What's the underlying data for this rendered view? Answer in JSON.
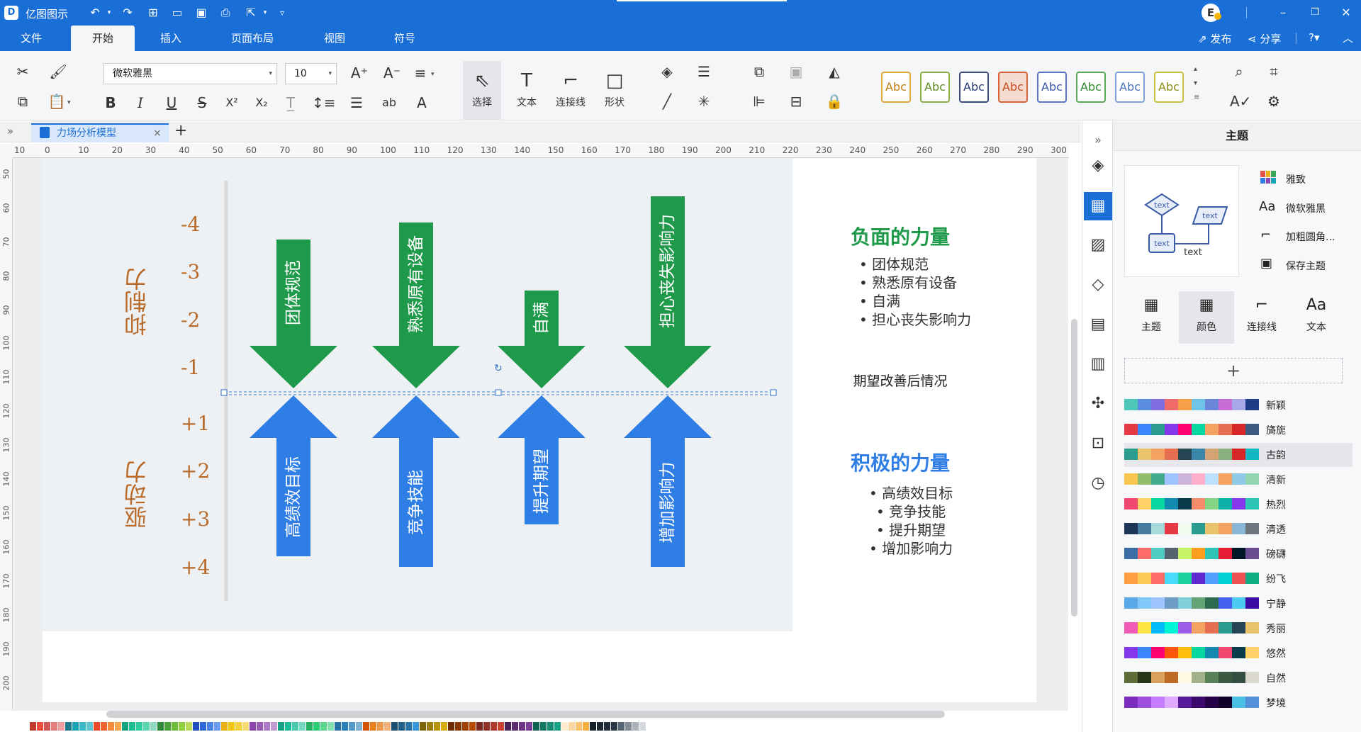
{
  "app": {
    "title": "亿图图示"
  },
  "menu_tabs": [
    "文件",
    "开始",
    "插入",
    "页面布局",
    "视图",
    "符号"
  ],
  "title_actions": {
    "avatar": "E",
    "publish": "发布",
    "share": "分享"
  },
  "ribbon": {
    "font_family": "微软雅黑",
    "font_size": "10",
    "big_buttons": [
      "选择",
      "文本",
      "连接线",
      "形状"
    ],
    "style_swatches": [
      {
        "label": "Abc",
        "border": "#e0a840",
        "color": "#c07c10"
      },
      {
        "label": "Abc",
        "border": "#8cae4a",
        "color": "#5d8a20"
      },
      {
        "label": "Abc",
        "border": "#3a4e82",
        "color": "#253a70"
      },
      {
        "label": "Abc",
        "border": "#d8633a",
        "color": "#c04a20"
      },
      {
        "label": "Abc",
        "border": "#5a74c8",
        "color": "#3a54a8"
      },
      {
        "label": "Abc",
        "border": "#58a858",
        "color": "#2f8a2f"
      },
      {
        "label": "Abc",
        "border": "#7ea0d8",
        "color": "#4a70b8"
      },
      {
        "label": "Abc",
        "border": "#c8c040",
        "color": "#8a8a10"
      }
    ]
  },
  "document": {
    "tab_label": "力场分析模型"
  },
  "ruler": {
    "h_labels": [
      "10",
      "0",
      "10",
      "20",
      "30",
      "40",
      "50",
      "60",
      "70",
      "80",
      "90",
      "100",
      "110",
      "120",
      "130",
      "140",
      "150",
      "160",
      "170",
      "180",
      "190",
      "200",
      "210",
      "220",
      "230",
      "240",
      "250",
      "260",
      "270",
      "280",
      "290",
      "300"
    ],
    "v_labels": [
      "50",
      "60",
      "70",
      "80",
      "90",
      "100",
      "110",
      "120",
      "130",
      "140",
      "150",
      "160",
      "170",
      "180",
      "190",
      "200"
    ]
  },
  "diagram": {
    "restrain_label": "抑制力",
    "drive_label": "驱动力",
    "scale_neg": [
      "-4",
      "-3",
      "-2",
      "-1"
    ],
    "scale_pos": [
      "+1",
      "+2",
      "+3",
      "+4"
    ],
    "down_arrows": [
      "团体规范",
      "熟悉原有设备",
      "自满",
      "担心丧失影响力"
    ],
    "up_arrows": [
      "高绩效目标",
      "竞争技能",
      "提升期望",
      "增加影响力"
    ],
    "green": "#1f9a4a",
    "blue": "#2f7ee6",
    "negative_title": "负面的力量",
    "negative_items": [
      "团体规范",
      "熟悉原有设备",
      "自满",
      "担心丧失影响力"
    ],
    "expectation_text": "期望改善后情况",
    "positive_title": "积极的力量",
    "positive_items": [
      "高绩效目标",
      "竞争技能",
      "提升期望",
      "增加影响力"
    ]
  },
  "panel": {
    "title": "主题",
    "preview_text": [
      "text",
      "text",
      "text",
      "text"
    ],
    "options": [
      "雅致",
      "微软雅黑",
      "加粗圆角...",
      "保存主题"
    ],
    "tabs": [
      "主题",
      "颜色",
      "连接线",
      "文本"
    ],
    "add_label": "+",
    "color_themes": [
      {
        "name": "新颖",
        "colors": [
          "#4fc7b8",
          "#5a8de0",
          "#7e6ee0",
          "#f06a6a",
          "#f6a04a",
          "#6fc4e8",
          "#6b86d6",
          "#c76ed6",
          "#a8a8e8",
          "#1f3c88"
        ]
      },
      {
        "name": "旖旎",
        "colors": [
          "#e63946",
          "#3a86ff",
          "#2a9d8f",
          "#8338ec",
          "#ff006e",
          "#06d6a0",
          "#f4a261",
          "#e76f51",
          "#d62828",
          "#3d5a80"
        ]
      },
      {
        "name": "古韵",
        "colors": [
          "#2a9d8f",
          "#e9c46a",
          "#f4a261",
          "#e76f51",
          "#264653",
          "#3a86a8",
          "#d4a373",
          "#8ab17d",
          "#d62828",
          "#14b8c4"
        ]
      },
      {
        "name": "清新",
        "colors": [
          "#f9c74f",
          "#90be6d",
          "#43aa8b",
          "#a0c4ff",
          "#cdb4db",
          "#ffafcc",
          "#bde0fe",
          "#f4a261",
          "#8ecae6",
          "#95d5b2"
        ]
      },
      {
        "name": "热烈",
        "colors": [
          "#ef476f",
          "#ffd166",
          "#06d6a0",
          "#118ab2",
          "#073b4c",
          "#f78c6b",
          "#83d483",
          "#0cb0a9",
          "#8338ec",
          "#2ec4b6"
        ]
      },
      {
        "name": "清透",
        "colors": [
          "#1d3557",
          "#457b9d",
          "#a8dadc",
          "#e63946",
          "#f1faee",
          "#2a9d8f",
          "#e9c46a",
          "#f4a261",
          "#8ab6d6",
          "#6c757d"
        ]
      },
      {
        "name": "磅礴",
        "colors": [
          "#3a6ea5",
          "#ff6b6b",
          "#4ecdc4",
          "#556270",
          "#c7f464",
          "#ff9f1c",
          "#2ec4b6",
          "#e71d36",
          "#011627",
          "#6a4c93"
        ]
      },
      {
        "name": "纷飞",
        "colors": [
          "#ff9f43",
          "#feca57",
          "#ff6b6b",
          "#48dbfb",
          "#1dd1a1",
          "#5f27cd",
          "#54a0ff",
          "#00d2d3",
          "#ee5253",
          "#10ac84"
        ]
      },
      {
        "name": "宁静",
        "colors": [
          "#5aa9e6",
          "#7fc8f8",
          "#a0c4ff",
          "#6d9dc5",
          "#80ced7",
          "#63a375",
          "#2d6a4f",
          "#4361ee",
          "#4cc9f0",
          "#3a0ca3"
        ]
      },
      {
        "name": "秀丽",
        "colors": [
          "#f15bb5",
          "#fee440",
          "#00bbf9",
          "#00f5d4",
          "#9b5de5",
          "#f4a261",
          "#e76f51",
          "#2a9d8f",
          "#264653",
          "#e9c46a"
        ]
      },
      {
        "name": "悠然",
        "colors": [
          "#8338ec",
          "#3a86ff",
          "#ff006e",
          "#fb5607",
          "#ffbe0b",
          "#06d6a0",
          "#118ab2",
          "#ef476f",
          "#073b4c",
          "#ffd166"
        ]
      },
      {
        "name": "自然",
        "colors": [
          "#606c38",
          "#283618",
          "#dda15e",
          "#bc6c25",
          "#fefae0",
          "#a3b18a",
          "#588157",
          "#3a5a40",
          "#344e41",
          "#dad7cd"
        ]
      },
      {
        "name": "梦境",
        "colors": [
          "#7b2cbf",
          "#9d4edd",
          "#c77dff",
          "#e0aaff",
          "#5a189a",
          "#3c096c",
          "#240046",
          "#10002b",
          "#48bfe3",
          "#5390d9"
        ]
      }
    ]
  },
  "palette": [
    "#c0392b",
    "#e74c3c",
    "#d35454",
    "#e67e80",
    "#f19ea0",
    "#1a7a8c",
    "#1aa3b5",
    "#3bb8c8",
    "#5cc5d3",
    "#e84a2a",
    "#f06430",
    "#f58a3c",
    "#f7a64e",
    "#14a37f",
    "#1cbc93",
    "#2ecc9f",
    "#58d6b0",
    "#8fd9c0",
    "#2f8b3a",
    "#4aa33a",
    "#6cbd3a",
    "#90d040",
    "#b8dc58",
    "#1f4fbf",
    "#2e67d8",
    "#4b82e6",
    "#6a9cf0",
    "#e9b113",
    "#f1c40f",
    "#f4d03f",
    "#f7dc6f",
    "#8e44ad",
    "#9b59b6",
    "#af7ac5",
    "#c39bd3",
    "#16a085",
    "#1abc9c",
    "#48c9b0",
    "#76d7c4",
    "#27ae60",
    "#2ecc71",
    "#58d68d",
    "#82e0aa",
    "#2471a3",
    "#2980b9",
    "#5499c7",
    "#7fb3d5",
    "#d35400",
    "#e67e22",
    "#eb984e",
    "#f0b27a",
    "#1b4f72",
    "#21618c",
    "#2874a6",
    "#3498db",
    "#7d6608",
    "#9a7d0a",
    "#b7950b",
    "#d4ac0d",
    "#6e2c00",
    "#873600",
    "#a04000",
    "#ba4a00",
    "#78281f",
    "#943126",
    "#b03a2e",
    "#cb4335",
    "#4a235a",
    "#5b2c6f",
    "#6c3483",
    "#7d3c98",
    "#0e6251",
    "#117864",
    "#138d75",
    "#16a085",
    "#fdebd0",
    "#fad7a0",
    "#f8c471",
    "#f5b041",
    "#17202a",
    "#1c2833",
    "#212f3d",
    "#273746",
    "#566573",
    "#808b96",
    "#abb2b9",
    "#d5d8dc"
  ]
}
